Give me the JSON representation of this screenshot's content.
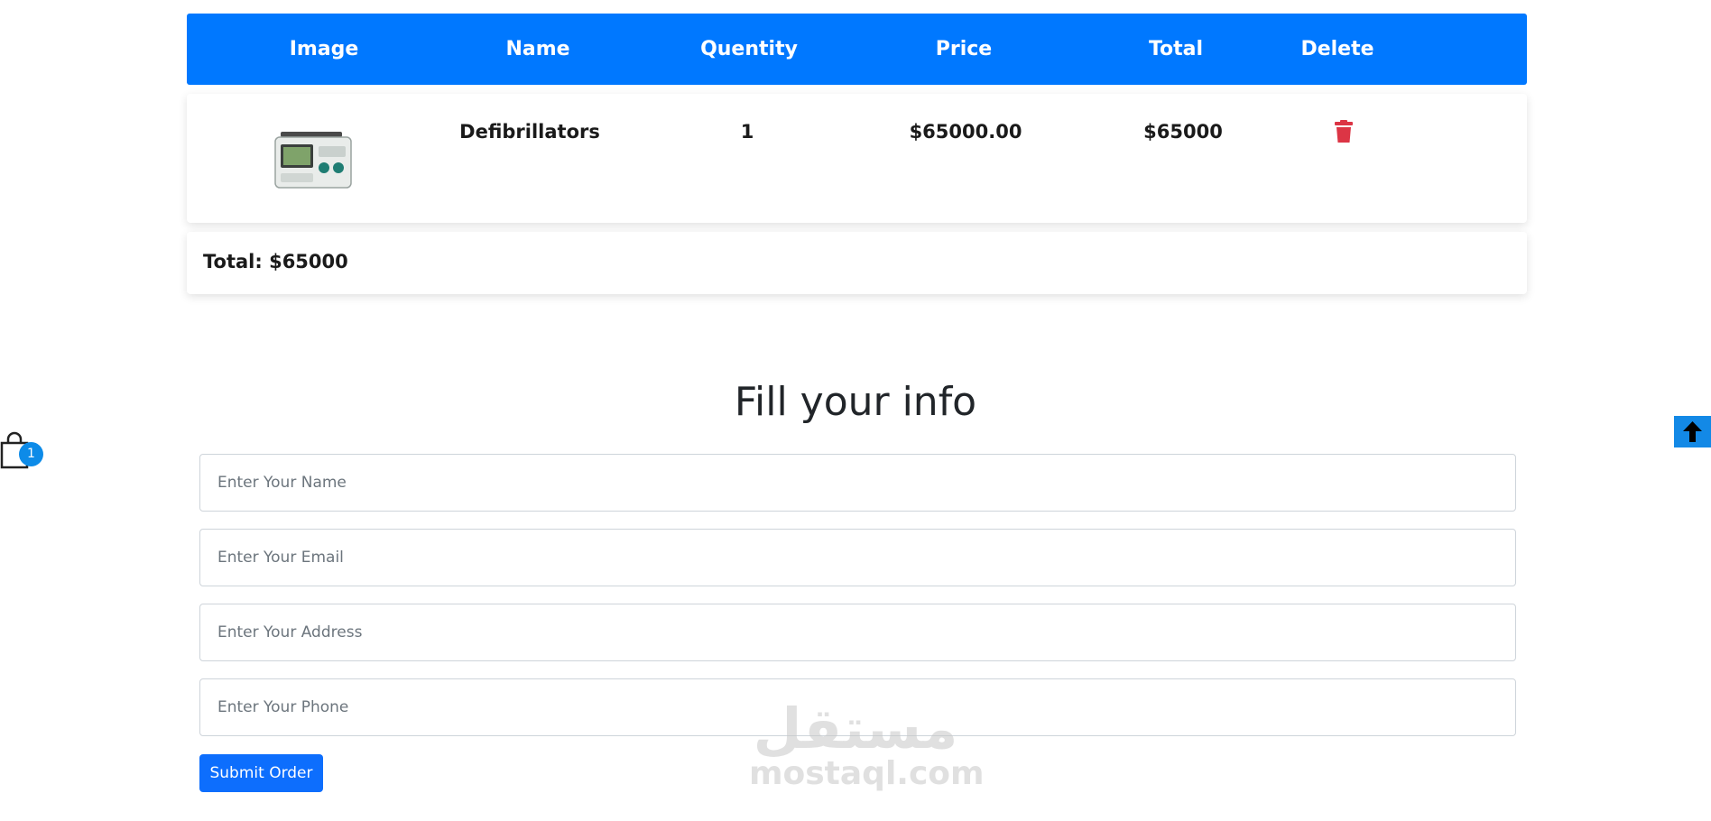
{
  "cart": {
    "headers": [
      "Image",
      "Name",
      "Quentity",
      "Price",
      "Total",
      "Delete"
    ],
    "items": [
      {
        "name": "Defibrillators",
        "quantity": "1",
        "price": "$65000.00",
        "total": "$65000"
      }
    ],
    "grand_total": "Total: $65000"
  },
  "form": {
    "title": "Fill your info",
    "name_placeholder": "Enter Your Name",
    "email_placeholder": "Enter Your Email",
    "address_placeholder": "Enter Your Address",
    "phone_placeholder": "Enter Your Phone",
    "submit_label": "Submit Order"
  },
  "floating": {
    "cart_count": "1"
  },
  "watermark": {
    "logo": "مستقل",
    "text": "mostaql.com"
  },
  "colors": {
    "header_bg": "#0078ff",
    "delete_icon": "#dc3545",
    "submit_bg": "#0d6efd",
    "badge_bg": "#0d8be8",
    "scroll_top_bg": "#1389e6"
  },
  "icons": [
    "trash-icon",
    "shopping-bag-icon",
    "arrow-up-icon"
  ]
}
